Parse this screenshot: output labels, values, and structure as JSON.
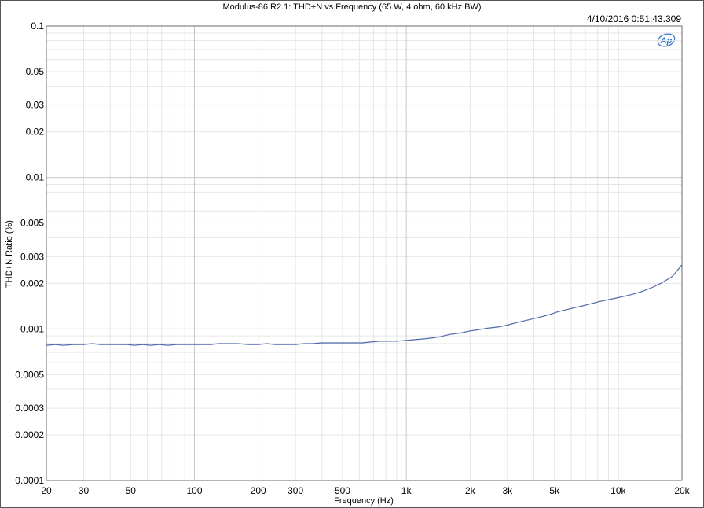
{
  "chart_data": {
    "type": "line",
    "title": "Modulus-86 R2.1: THD+N vs Frequency (65 W, 4 ohm, 60 kHz BW)",
    "timestamp": "4/10/2016 0:51:43.309",
    "logo": "Ap",
    "xlabel": "Frequency (Hz)",
    "ylabel": "THD+N Ratio (%)",
    "xscale": "log",
    "yscale": "log",
    "xlim": [
      20,
      20000
    ],
    "ylim": [
      0.0001,
      0.1
    ],
    "grid": true,
    "x_ticks": [
      {
        "value": 20,
        "label": "20"
      },
      {
        "value": 30,
        "label": "30"
      },
      {
        "value": 50,
        "label": "50"
      },
      {
        "value": 100,
        "label": "100"
      },
      {
        "value": 200,
        "label": "200"
      },
      {
        "value": 300,
        "label": "300"
      },
      {
        "value": 500,
        "label": "500"
      },
      {
        "value": 1000,
        "label": "1k"
      },
      {
        "value": 2000,
        "label": "2k"
      },
      {
        "value": 3000,
        "label": "3k"
      },
      {
        "value": 5000,
        "label": "5k"
      },
      {
        "value": 10000,
        "label": "10k"
      },
      {
        "value": 20000,
        "label": "20k"
      }
    ],
    "y_ticks": [
      {
        "value": 0.1,
        "label": "0.1"
      },
      {
        "value": 0.05,
        "label": "0.05"
      },
      {
        "value": 0.03,
        "label": "0.03"
      },
      {
        "value": 0.02,
        "label": "0.02"
      },
      {
        "value": 0.01,
        "label": "0.01"
      },
      {
        "value": 0.005,
        "label": "0.005"
      },
      {
        "value": 0.003,
        "label": "0.003"
      },
      {
        "value": 0.002,
        "label": "0.002"
      },
      {
        "value": 0.001,
        "label": "0.001"
      },
      {
        "value": 0.0005,
        "label": "0.0005"
      },
      {
        "value": 0.0003,
        "label": "0.0003"
      },
      {
        "value": 0.0002,
        "label": "0.0002"
      },
      {
        "value": 0.0001,
        "label": "0.0001"
      }
    ],
    "series": [
      {
        "color": "#4f6aa8",
        "x": [
          20,
          22,
          24,
          27,
          30,
          33,
          36,
          40,
          44,
          48,
          52,
          57,
          62,
          68,
          75,
          82,
          90,
          100,
          110,
          120,
          130,
          145,
          160,
          180,
          200,
          220,
          240,
          270,
          300,
          330,
          360,
          400,
          440,
          480,
          520,
          570,
          620,
          680,
          750,
          820,
          900,
          1000,
          1100,
          1200,
          1300,
          1450,
          1600,
          1800,
          2000,
          2200,
          2400,
          2700,
          3000,
          3300,
          3600,
          4000,
          4400,
          4800,
          5200,
          5700,
          6200,
          6800,
          7500,
          8200,
          9000,
          10000,
          11000,
          12000,
          13000,
          14500,
          16000,
          18000,
          20000
        ],
        "values": [
          0.00078,
          0.00079,
          0.00078,
          0.00079,
          0.00079,
          0.0008,
          0.00079,
          0.00079,
          0.00079,
          0.00079,
          0.00078,
          0.00079,
          0.00078,
          0.00079,
          0.00078,
          0.00079,
          0.00079,
          0.00079,
          0.00079,
          0.00079,
          0.0008,
          0.0008,
          0.0008,
          0.00079,
          0.00079,
          0.0008,
          0.00079,
          0.00079,
          0.00079,
          0.0008,
          0.0008,
          0.00081,
          0.00081,
          0.00081,
          0.00081,
          0.00081,
          0.00081,
          0.00082,
          0.00083,
          0.00083,
          0.00083,
          0.00084,
          0.00085,
          0.00086,
          0.00087,
          0.00089,
          0.00092,
          0.00094,
          0.00097,
          0.00099,
          0.00101,
          0.00103,
          0.00106,
          0.0011,
          0.00113,
          0.00117,
          0.00121,
          0.00125,
          0.0013,
          0.00134,
          0.00138,
          0.00142,
          0.00147,
          0.00152,
          0.00156,
          0.00161,
          0.00166,
          0.00171,
          0.00177,
          0.00188,
          0.00201,
          0.00222,
          0.00265
        ]
      }
    ]
  }
}
